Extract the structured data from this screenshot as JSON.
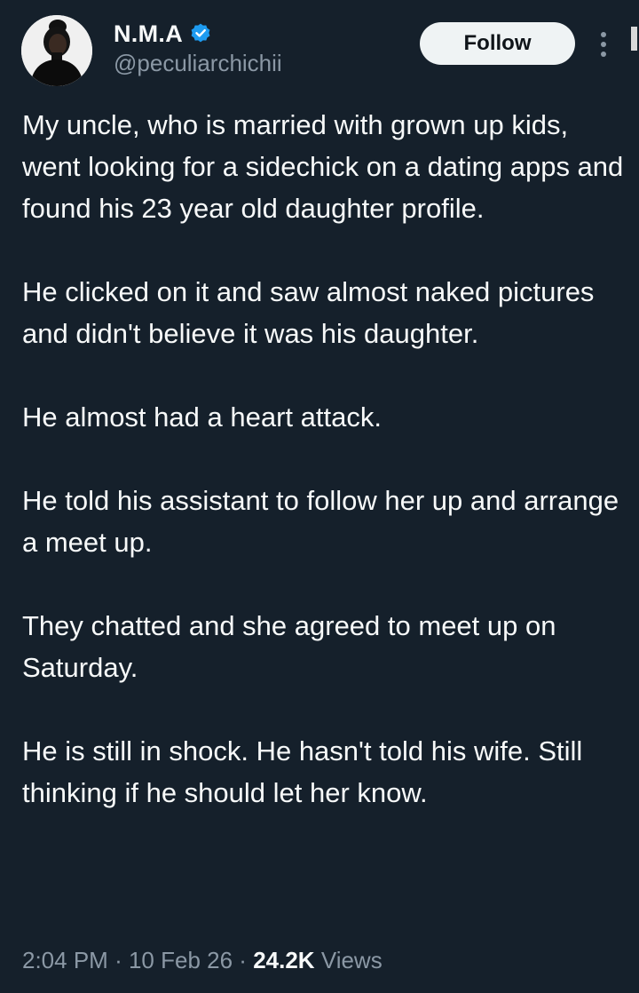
{
  "author": {
    "display_name": "N.M.A",
    "handle": "@peculiarchichii",
    "verified": true,
    "verified_color": "#1d9bf0"
  },
  "follow_label": "Follow",
  "more_icon": "vertical-ellipsis-icon",
  "tweet": {
    "paragraphs": [
      "My uncle, who is married with grown up kids, went looking for a sidechick on a dating apps and found his 23 year old daughter profile.",
      "He clicked on it and saw almost naked pictures and didn't believe it was his daughter.",
      "He almost had a heart attack.",
      "He told his assistant to follow her up and arrange a meet up.",
      "They chatted and she agreed to meet up on Saturday.",
      "He is still in shock. He hasn't told his wife. Still thinking if he should let her know."
    ]
  },
  "meta": {
    "time": "2:04 PM",
    "separator": "·",
    "date": "10 Feb 26",
    "views_count": "24.2K",
    "views_label": "Views"
  },
  "colors": {
    "background": "#15202b",
    "text": "#f7f9f9",
    "secondary_text": "#8b98a5",
    "button_bg": "#eff3f4",
    "button_text": "#0f1419"
  }
}
